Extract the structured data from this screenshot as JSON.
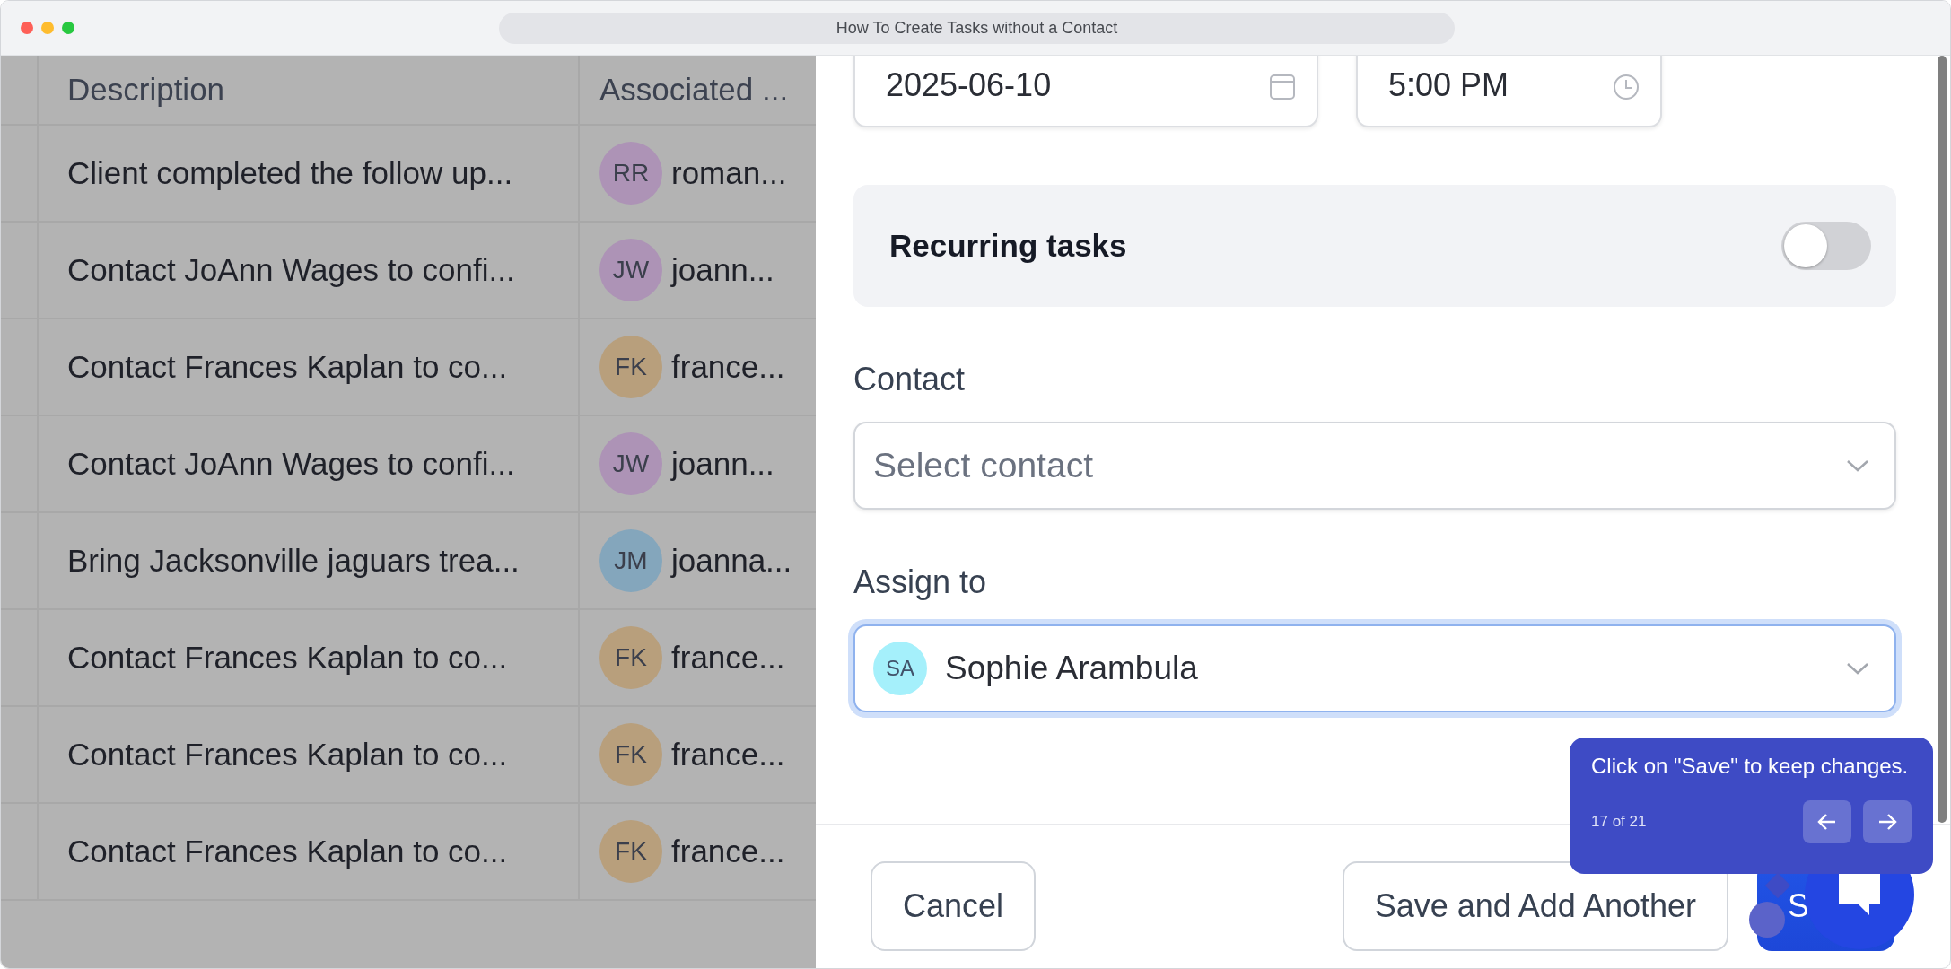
{
  "browser": {
    "title": "How To Create Tasks without a Contact"
  },
  "table": {
    "columns": [
      "Description",
      "Associated ..."
    ],
    "rows": [
      {
        "description": "Client completed the follow up...",
        "initials": "RR",
        "name": "roman...",
        "color": "#ad93b6"
      },
      {
        "description": "Contact JoAnn Wages to confi...",
        "initials": "JW",
        "name": "joann...",
        "color": "#ad93b6"
      },
      {
        "description": "Contact Frances Kaplan to co...",
        "initials": "FK",
        "name": "france...",
        "color": "#b89f7c"
      },
      {
        "description": "Contact JoAnn Wages to confi...",
        "initials": "JW",
        "name": "joann...",
        "color": "#ad93b6"
      },
      {
        "description": "Bring Jacksonville jaguars trea...",
        "initials": "JM",
        "name": "joanna...",
        "color": "#84a6bc"
      },
      {
        "description": "Contact Frances Kaplan to co...",
        "initials": "FK",
        "name": "france...",
        "color": "#b89f7c"
      },
      {
        "description": "Contact Frances Kaplan to co...",
        "initials": "FK",
        "name": "france...",
        "color": "#b89f7c"
      },
      {
        "description": "Contact Frances Kaplan to co...",
        "initials": "FK",
        "name": "france...",
        "color": "#b89f7c"
      }
    ]
  },
  "form": {
    "due_date": "2025-06-10",
    "due_time": "5:00 PM",
    "recurring": {
      "label": "Recurring tasks",
      "on": false
    },
    "contact": {
      "label": "Contact",
      "placeholder": "Select contact"
    },
    "assign": {
      "label": "Assign to",
      "initials": "SA",
      "value": "Sophie Arambula",
      "focused": true
    },
    "buttons": [
      {
        "label": "Cancel",
        "kind": "secondary"
      },
      {
        "label": "Save and Add Another",
        "kind": "secondary"
      },
      {
        "label": "S",
        "kind": "primary"
      }
    ]
  },
  "guide": {
    "text": "Click on \"Save\" to keep changes.",
    "step": "17 of 21"
  }
}
